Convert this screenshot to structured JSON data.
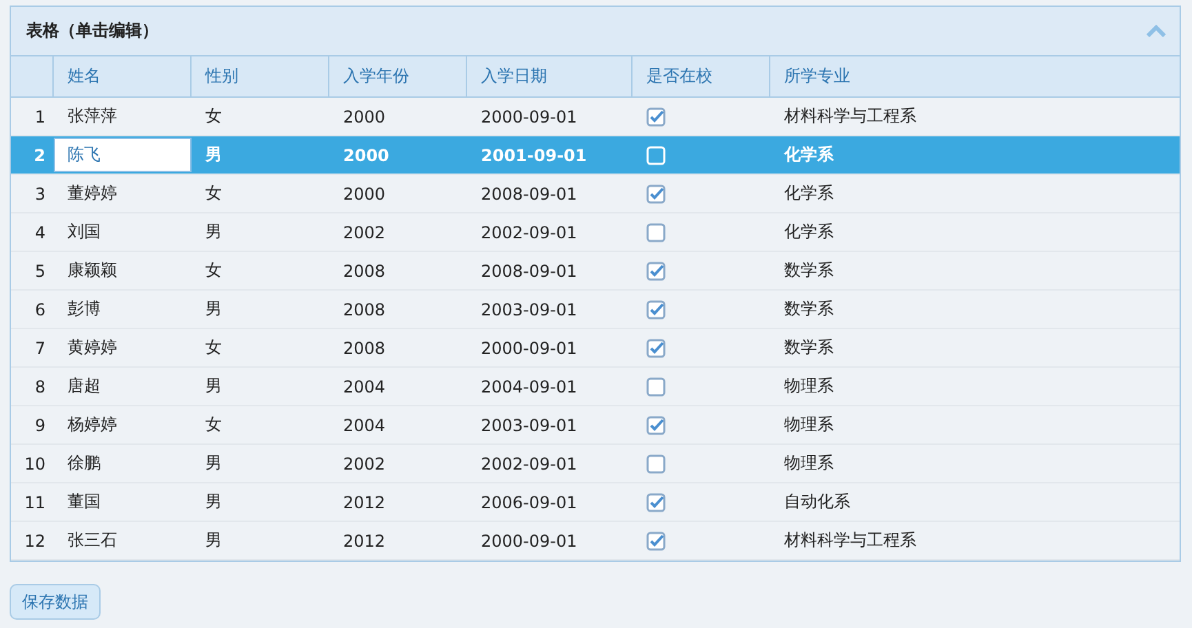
{
  "panel": {
    "title": "表格（单击编辑）"
  },
  "table": {
    "columns": [
      "姓名",
      "性别",
      "入学年份",
      "入学日期",
      "是否在校",
      "所学专业"
    ],
    "rows": [
      {
        "index": "1",
        "name": "张萍萍",
        "gender": "女",
        "year": "2000",
        "date": "2000-09-01",
        "enrolled": true,
        "major": "材料科学与工程系",
        "selected": false,
        "editing": false
      },
      {
        "index": "2",
        "name": "陈飞",
        "gender": "男",
        "year": "2000",
        "date": "2001-09-01",
        "enrolled": false,
        "major": "化学系",
        "selected": true,
        "editing": true
      },
      {
        "index": "3",
        "name": "董婷婷",
        "gender": "女",
        "year": "2000",
        "date": "2008-09-01",
        "enrolled": true,
        "major": "化学系",
        "selected": false,
        "editing": false
      },
      {
        "index": "4",
        "name": "刘国",
        "gender": "男",
        "year": "2002",
        "date": "2002-09-01",
        "enrolled": false,
        "major": "化学系",
        "selected": false,
        "editing": false
      },
      {
        "index": "5",
        "name": "康颖颖",
        "gender": "女",
        "year": "2008",
        "date": "2008-09-01",
        "enrolled": true,
        "major": "数学系",
        "selected": false,
        "editing": false
      },
      {
        "index": "6",
        "name": "彭博",
        "gender": "男",
        "year": "2008",
        "date": "2003-09-01",
        "enrolled": true,
        "major": "数学系",
        "selected": false,
        "editing": false
      },
      {
        "index": "7",
        "name": "黄婷婷",
        "gender": "女",
        "year": "2008",
        "date": "2000-09-01",
        "enrolled": true,
        "major": "数学系",
        "selected": false,
        "editing": false
      },
      {
        "index": "8",
        "name": "唐超",
        "gender": "男",
        "year": "2004",
        "date": "2004-09-01",
        "enrolled": false,
        "major": "物理系",
        "selected": false,
        "editing": false
      },
      {
        "index": "9",
        "name": "杨婷婷",
        "gender": "女",
        "year": "2004",
        "date": "2003-09-01",
        "enrolled": true,
        "major": "物理系",
        "selected": false,
        "editing": false
      },
      {
        "index": "10",
        "name": "徐鹏",
        "gender": "男",
        "year": "2002",
        "date": "2002-09-01",
        "enrolled": false,
        "major": "物理系",
        "selected": false,
        "editing": false
      },
      {
        "index": "11",
        "name": "董国",
        "gender": "男",
        "year": "2012",
        "date": "2006-09-01",
        "enrolled": true,
        "major": "自动化系",
        "selected": false,
        "editing": false
      },
      {
        "index": "12",
        "name": "张三石",
        "gender": "男",
        "year": "2012",
        "date": "2000-09-01",
        "enrolled": true,
        "major": "材料科学与工程系",
        "selected": false,
        "editing": false
      }
    ]
  },
  "buttons": [
    "保存数据"
  ]
}
